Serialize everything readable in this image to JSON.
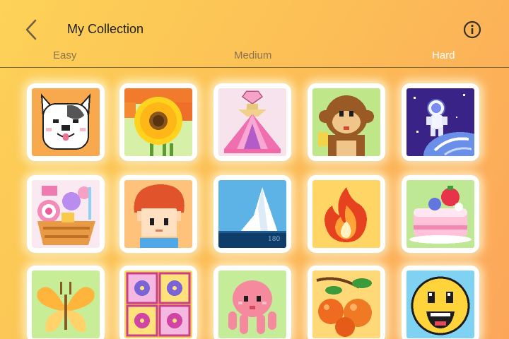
{
  "header": {
    "back_icon": "chevron-left-icon",
    "title": "My Collection",
    "info_icon": "info-icon"
  },
  "tabs": [
    {
      "label": "Easy",
      "active": false
    },
    {
      "label": "Medium",
      "active": false
    },
    {
      "label": "Hard",
      "active": true
    }
  ],
  "colors": {
    "background_start": "#fdd257",
    "background_end": "#fca65a",
    "tab_inactive": "#8a7352",
    "tab_active": "#ffffff"
  },
  "artworks": [
    {
      "subject": "french-bulldog"
    },
    {
      "subject": "sunflower"
    },
    {
      "subject": "pink-perfume-bottle"
    },
    {
      "subject": "monkey"
    },
    {
      "subject": "astronaut"
    },
    {
      "subject": "candy-basket"
    },
    {
      "subject": "red-haired-boy"
    },
    {
      "subject": "iceberg",
      "label": "180"
    },
    {
      "subject": "fire"
    },
    {
      "subject": "strawberry-cake"
    },
    {
      "subject": "butterfly"
    },
    {
      "subject": "flower-tiles"
    },
    {
      "subject": "octopus"
    },
    {
      "subject": "oranges"
    },
    {
      "subject": "smiley-face"
    }
  ]
}
